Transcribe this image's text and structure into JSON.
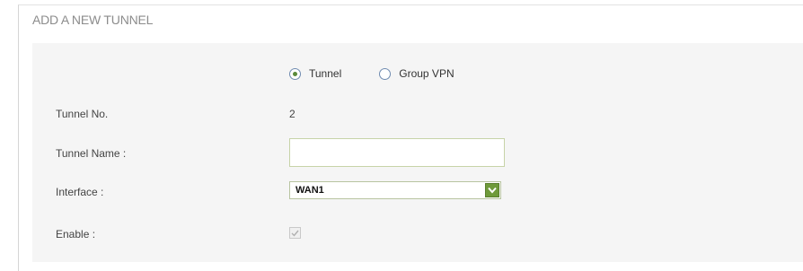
{
  "section": {
    "title": "ADD A NEW TUNNEL"
  },
  "tunnel_type": {
    "options": [
      {
        "label": "Tunnel",
        "selected": true
      },
      {
        "label": "Group VPN",
        "selected": false
      }
    ]
  },
  "form": {
    "tunnel_no": {
      "label": "Tunnel No.",
      "value": "2"
    },
    "tunnel_name": {
      "label": "Tunnel Name :",
      "value": "",
      "placeholder": ""
    },
    "interface": {
      "label": "Interface :",
      "selected": "WAN1"
    },
    "enable": {
      "label": "Enable :",
      "checked": true
    }
  },
  "colors": {
    "accent_green": "#6f9a3a",
    "panel_background": "#f5f5f5",
    "radio_border": "#6f8bb0"
  }
}
